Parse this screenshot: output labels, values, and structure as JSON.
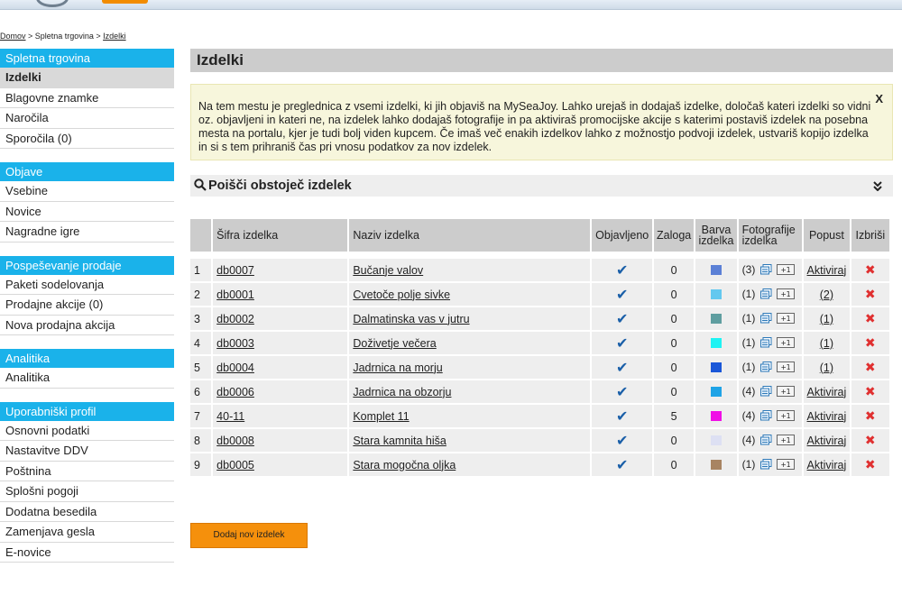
{
  "breadcrumb": {
    "home": "Domov",
    "sep1": " > ",
    "shop": "Spletna trgovina",
    "sep2": " > ",
    "current": "Izdelki"
  },
  "sidebar": {
    "groups": [
      {
        "title": "Spletna trgovina",
        "items": [
          "Izdelki",
          "Blagovne znamke",
          "Naročila",
          "Sporočila (0)"
        ]
      },
      {
        "title": "Objave",
        "items": [
          "Vsebine",
          "Novice",
          "Nagradne igre"
        ]
      },
      {
        "title": "Pospeševanje prodaje",
        "items": [
          "Paketi sodelovanja",
          "Prodajne akcije (0)",
          "Nova prodajna akcija"
        ]
      },
      {
        "title": "Analitika",
        "items": [
          "Analitika"
        ]
      },
      {
        "title": "Uporabniški profil",
        "items": [
          "Osnovni podatki",
          "Nastavitve DDV",
          "Poštnina",
          "Splošni pogoji",
          "Dodatna besedila",
          "Zamenjava gesla",
          "E-novice"
        ]
      }
    ]
  },
  "main": {
    "title": "Izdelki",
    "info": "Na tem mestu je preglednica z vsemi izdelki, ki jih objaviš na MySeaJoy. Lahko urejaš in dodajaš izdelke, določaš kateri izdelki so vidni oz. objavljeni in kateri ne, na izdelek lahko dodajaš fotografije in pa aktiviraš promocijske akcije s katerimi postaviš izdelek na posebna mesta na portalu, kjer je tudi bolj viden kupcem. Če imaš več enakih izdelkov lahko z možnostjo podvoji izdelek, ustvariš kopijo izdelka in si s tem prihraniš čas pri vnosu podatkov za nov izdelek.",
    "info_close": "X",
    "search_label": "Poišči obstoječ izdelek",
    "search_toggle": "»",
    "add_button": "Dodaj nov izdelek"
  },
  "table": {
    "headers": {
      "code": "Šifra izdelka",
      "name": "Naziv izdelka",
      "published": "Objavljeno",
      "stock": "Zaloga",
      "color_l1": "Barva",
      "color_l2": "izdelka",
      "photos_l1": "Fotografije",
      "photos_l2": "izdelka",
      "discount": "Popust",
      "delete": "Izbriši"
    },
    "published_mark": "✔",
    "photo_add_label": "+1",
    "delete_mark": "✖",
    "rows": [
      {
        "n": "1",
        "code": "db0007",
        "name": "Bučanje valov",
        "stock": "0",
        "color": "#5b80d6",
        "photos": "(3)",
        "discount": "Aktiviraj"
      },
      {
        "n": "2",
        "code": "db0001",
        "name": "Cvetoče polje sivke",
        "stock": "0",
        "color": "#63c8ef",
        "photos": "(1)",
        "discount": "(2)"
      },
      {
        "n": "3",
        "code": "db0002",
        "name": "Dalmatinska vas v jutru",
        "stock": "0",
        "color": "#5f9ea0",
        "photos": "(1)",
        "discount": "(1)"
      },
      {
        "n": "4",
        "code": "db0003",
        "name": "Doživetje večera",
        "stock": "0",
        "color": "#1ef3f3",
        "photos": "(1)",
        "discount": "(1)"
      },
      {
        "n": "5",
        "code": "db0004",
        "name": "Jadrnica na morju",
        "stock": "0",
        "color": "#1a57d8",
        "photos": "(1)",
        "discount": "(1)"
      },
      {
        "n": "6",
        "code": "db0006",
        "name": "Jadrnica na obzorju",
        "stock": "0",
        "color": "#1fa3e6",
        "photos": "(4)",
        "discount": "Aktiviraj"
      },
      {
        "n": "7",
        "code": "40-11",
        "name": "Komplet 11",
        "stock": "5",
        "color": "#f00ee6",
        "photos": "(4)",
        "discount": "Aktiviraj"
      },
      {
        "n": "8",
        "code": "db0008",
        "name": "Stara kamnita hiša",
        "stock": "0",
        "color": "#dde0f3",
        "photos": "(4)",
        "discount": "Aktiviraj"
      },
      {
        "n": "9",
        "code": "db0005",
        "name": "Stara mogočna oljka",
        "stock": "0",
        "color": "#a88462",
        "photos": "(1)",
        "discount": "Aktiviraj"
      }
    ]
  }
}
